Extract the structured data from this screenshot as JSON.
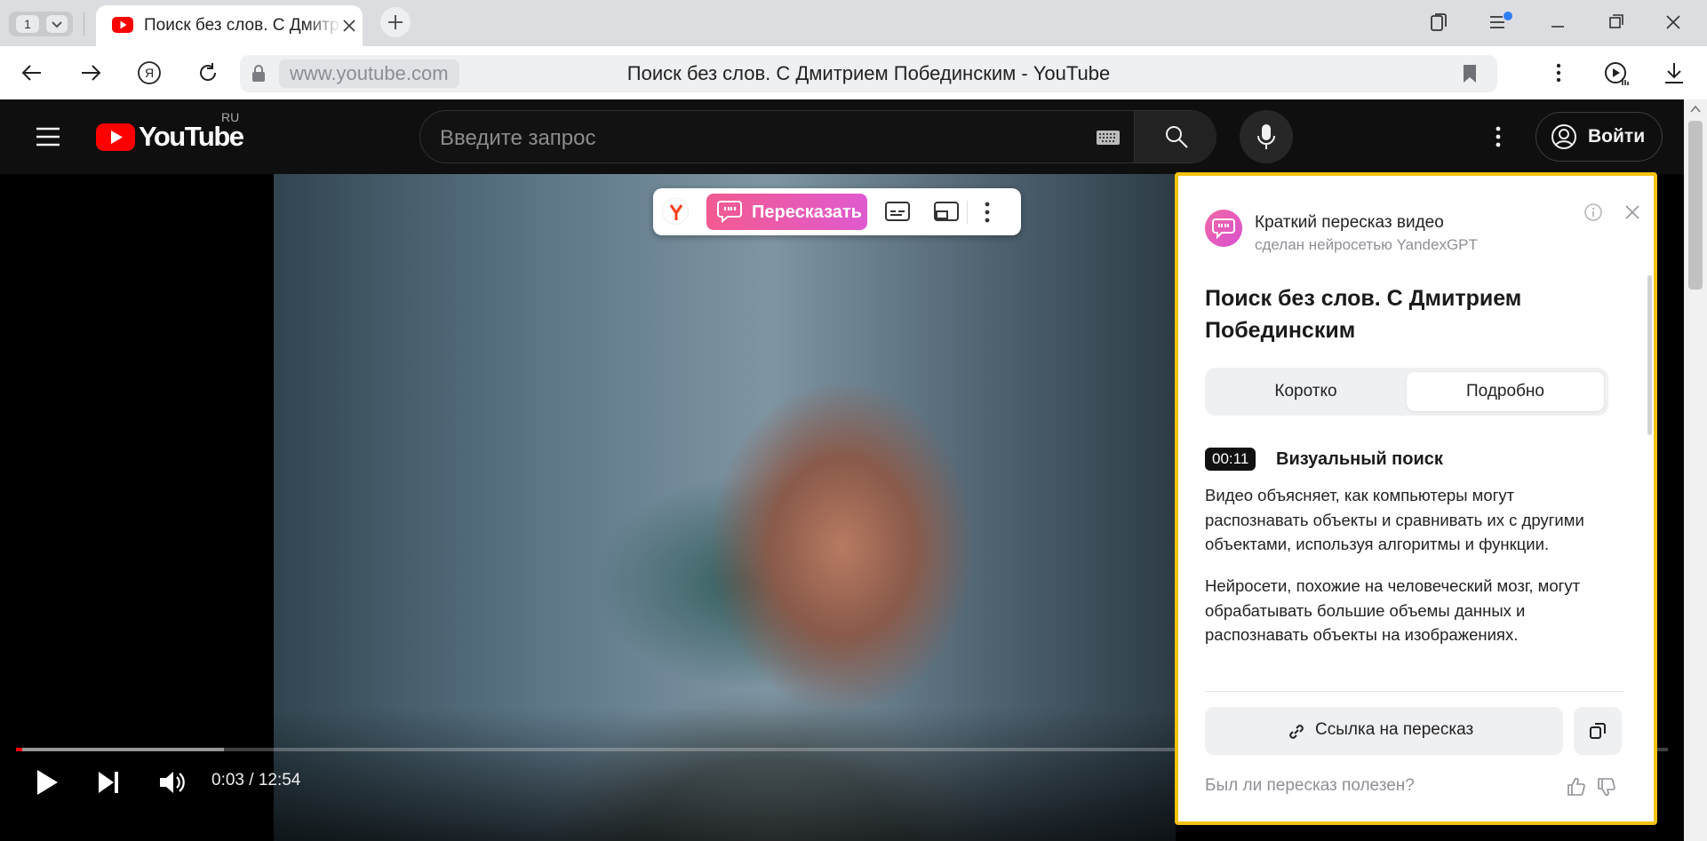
{
  "browser": {
    "tab_count": "1",
    "tab_title": "Поиск без слов. С Дмитрием Побединским",
    "address_host": "www.youtube.com",
    "page_title": "Поиск без слов. С Дмитрием Побединским - YouTube"
  },
  "youtube": {
    "logo_text": "YouTube",
    "region": "RU",
    "search_placeholder": "Введите запрос",
    "signin_label": "Войти"
  },
  "player": {
    "time_current": "0:03",
    "time_total": "12:54",
    "time_display": "0:03 / 12:54",
    "played_fraction": 0.004,
    "loaded_fraction": 0.126
  },
  "overlay_toolbar": {
    "retell_label": "Пересказать"
  },
  "summary_panel": {
    "header_title": "Краткий пересказ видео",
    "header_subtitle": "сделан нейросетью YandexGPT",
    "video_title": "Поиск без слов. С Дмитрием Побединским",
    "tabs": [
      "Коротко",
      "Подробно"
    ],
    "active_tab": "Подробно",
    "section": {
      "timestamp": "00:11",
      "heading": "Визуальный поиск",
      "paragraphs": [
        "Видео объясняет, как компьютеры могут распознавать объекты и сравнивать их с другими объектами, используя алгоритмы и функции.",
        "Нейросети, похожие на человеческий мозг, могут обрабатывать большие объемы данных и распознавать объекты на изображениях."
      ]
    },
    "link_button_label": "Ссылка на пересказ",
    "feedback_question": "Был ли пересказ полезен?"
  },
  "colors": {
    "highlight_border": "#f4c20d",
    "youtube_red": "#ff0000",
    "retell_gradient_start": "#f25a8f",
    "retell_gradient_end": "#e05ad0"
  }
}
